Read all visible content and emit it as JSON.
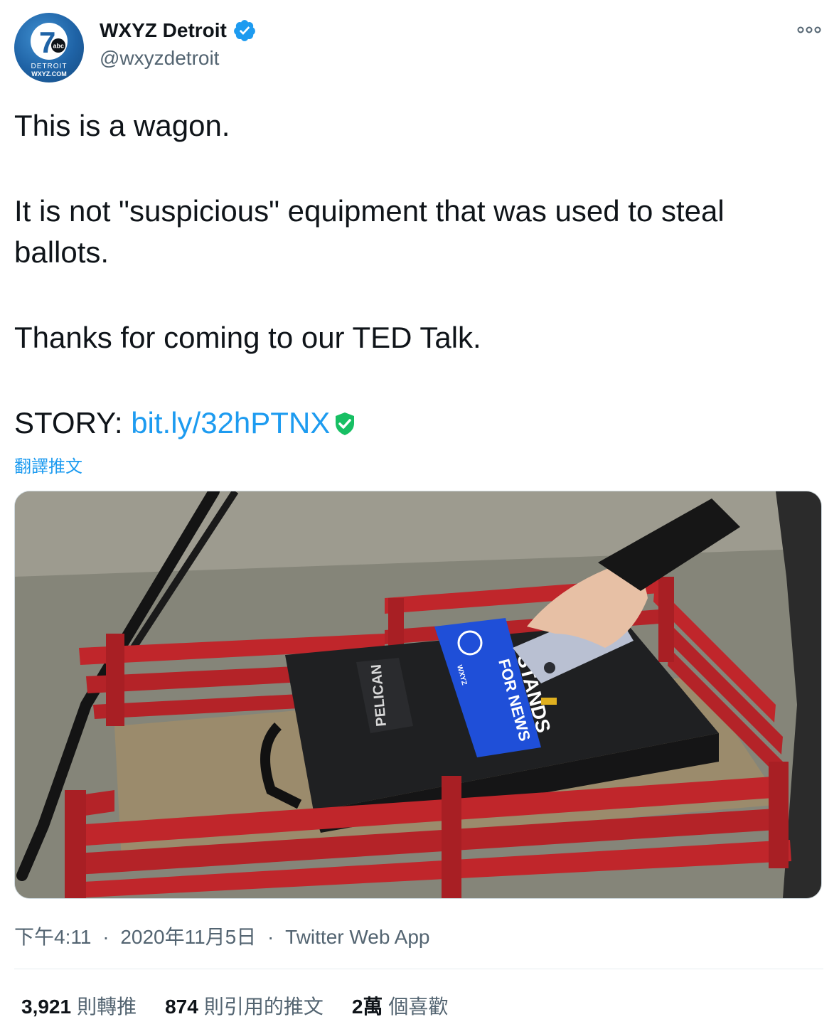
{
  "author": {
    "display_name": "WXYZ Detroit",
    "handle": "@wxyzdetroit",
    "avatar_text_top": "7",
    "avatar_badge": "abc",
    "avatar_text_line1": "DETROIT",
    "avatar_text_line2": "WXYZ.COM"
  },
  "tweet": {
    "line1": "This is a wagon.",
    "line2": "It is not \"suspicious\" equipment that was used to steal ballots.",
    "line3": "Thanks for coming to our TED Talk.",
    "story_prefix": "STORY: ",
    "story_link": "bit.ly/32hPTNX",
    "translate_label": "翻譯推文"
  },
  "media": {
    "case_brand": "PELICAN",
    "sticker_line1": "STANDS",
    "sticker_line2": "FOR NEWS",
    "sticker_small": "WXYZ"
  },
  "meta": {
    "time": "下午4:11",
    "date": "2020年11月5日",
    "source": "Twitter Web App",
    "separator": "·"
  },
  "stats": {
    "retweets_count": "3,921",
    "retweets_label": "則轉推",
    "quotes_count": "874",
    "quotes_label": "則引用的推文",
    "likes_count": "2萬",
    "likes_label": "個喜歡"
  },
  "colors": {
    "link": "#1d9bf0",
    "verified": "#1d9bf0",
    "shield": "#17bf63",
    "wagon_red": "#c0262b"
  },
  "icons": [
    "verified-badge-icon",
    "more-options-icon",
    "safe-link-shield-icon"
  ]
}
